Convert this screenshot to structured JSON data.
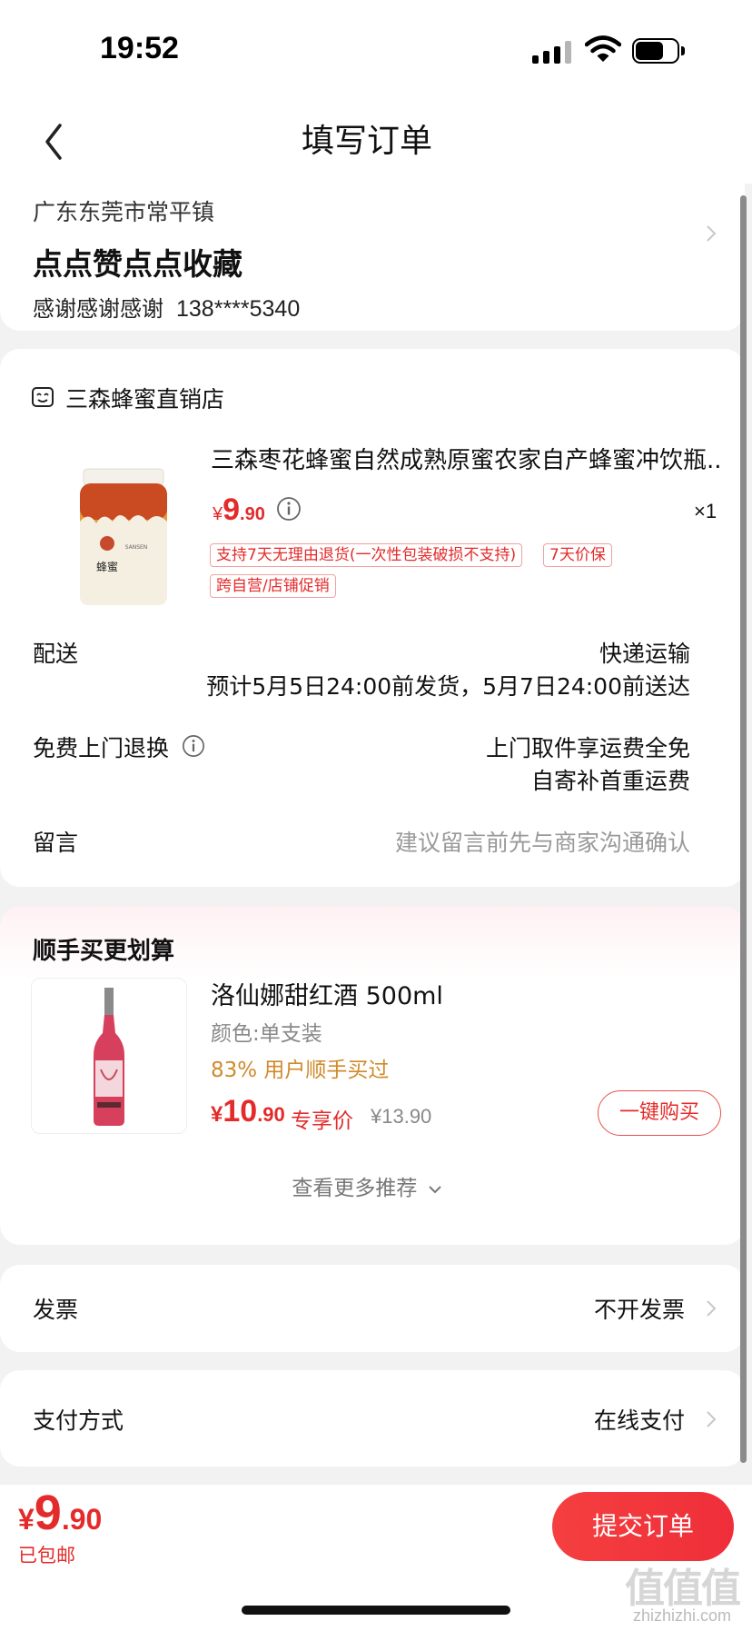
{
  "status_bar": {
    "time": "19:52"
  },
  "header": {
    "title": "填写订单"
  },
  "address": {
    "region": "广东东莞市常平镇",
    "detail": "点点赞点点收藏",
    "recipient": "感谢感谢感谢",
    "phone": "138****5340"
  },
  "shop": {
    "name": "三森蜂蜜直销店",
    "product": {
      "title": "三森枣花蜂蜜自然成熟原蜜农家自产蜂蜜冲饮瓶...",
      "price_symbol": "¥",
      "price_int": "9",
      "price_dec": ".90",
      "quantity": "×1",
      "tags": [
        "支持7天无理由退货(一次性包装破损不支持)",
        "7天价保",
        "跨自营/店铺促销"
      ]
    }
  },
  "delivery": {
    "label": "配送",
    "method": "快递运输",
    "estimate": "预计5月5日24:00前发货，5月7日24:00前送达"
  },
  "returns": {
    "label": "免费上门退换",
    "line1": "上门取件享运费全免",
    "line2": "自寄补首重运费"
  },
  "message": {
    "label": "留言",
    "placeholder": "建议留言前先与商家沟通确认"
  },
  "recommend": {
    "title": "顺手买更划算",
    "item": {
      "name": "洛仙娜甜红酒 500ml",
      "spec": "颜色:单支装",
      "buyers": "83% 用户顺手买过",
      "price_symbol": "¥",
      "price_int": "10",
      "price_dec": ".90",
      "price_tag": "专享价",
      "original_price": "¥13.90",
      "buy_label": "一键购买"
    },
    "more_label": "查看更多推荐"
  },
  "invoice": {
    "label": "发票",
    "value": "不开发票"
  },
  "payment": {
    "label": "支付方式",
    "value": "在线支付"
  },
  "footer": {
    "price_symbol": "¥",
    "price_int": "9",
    "price_dec": ".90",
    "shipping_note": "已包邮",
    "submit_label": "提交订单"
  },
  "watermark": {
    "title": "值值值",
    "url": "zhizhizhi.com"
  },
  "colors": {
    "accent": "#e42b2b",
    "buyers_highlight": "#d08a2a",
    "background": "#f2f2f2"
  }
}
